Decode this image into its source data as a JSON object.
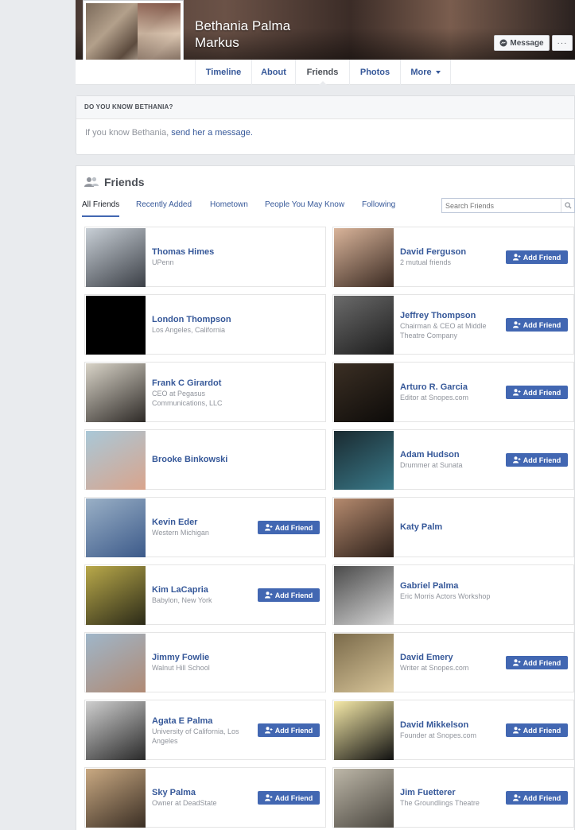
{
  "profile": {
    "name": "Bethania Palma Markus",
    "message_label": "Message",
    "more_dots": "···"
  },
  "tabs": [
    {
      "label": "Timeline"
    },
    {
      "label": "About"
    },
    {
      "label": "Friends"
    },
    {
      "label": "Photos"
    },
    {
      "label": "More"
    }
  ],
  "know_box": {
    "heading": "DO YOU KNOW BETHANIA?",
    "text": "If you know Bethania, ",
    "link": "send her a message.",
    "trail": ""
  },
  "friends": {
    "title": "Friends",
    "subtabs": [
      "All Friends",
      "Recently Added",
      "Hometown",
      "People You May Know",
      "Following"
    ],
    "search_placeholder": "Search Friends",
    "add_label": "Add Friend",
    "list": [
      {
        "name": "Thomas Himes",
        "sub": "UPenn",
        "add": false,
        "photo": [
          "#c8cfd6",
          "#3b3f46"
        ]
      },
      {
        "name": "David Ferguson",
        "sub": "2 mutual friends",
        "add": true,
        "photo": [
          "#d9b49a",
          "#3a2a22"
        ]
      },
      {
        "name": "London Thompson",
        "sub": "Los Angeles, California",
        "add": false,
        "photo": [
          "#000000",
          "#000000"
        ]
      },
      {
        "name": "Jeffrey Thompson",
        "sub": "Chairman & CEO at Middle Theatre Company",
        "add": true,
        "photo": [
          "#6b6b6b",
          "#1c1c1c"
        ]
      },
      {
        "name": "Frank C Girardot",
        "sub": "CEO at Pegasus Communications, LLC",
        "add": false,
        "photo": [
          "#d9d4c8",
          "#2e2a27"
        ]
      },
      {
        "name": "Arturo R. Garcia",
        "sub": "Editor at Snopes.com",
        "add": true,
        "photo": [
          "#3b2f24",
          "#0d0b09"
        ]
      },
      {
        "name": "Brooke Binkowski",
        "sub": "",
        "add": false,
        "photo": [
          "#a9c8d8",
          "#d9a48c"
        ]
      },
      {
        "name": "Adam Hudson",
        "sub": "Drummer at Sunata",
        "add": true,
        "photo": [
          "#1a2a30",
          "#3a7a8a"
        ]
      },
      {
        "name": "Kevin Eder",
        "sub": "Western Michigan",
        "add": true,
        "photo": [
          "#9ab0c6",
          "#3c5a8a"
        ]
      },
      {
        "name": "Katy Palm",
        "sub": "",
        "add": false,
        "photo": [
          "#b58a6e",
          "#2c201a"
        ]
      },
      {
        "name": "Kim LaCapria",
        "sub": "Babylon, New York",
        "add": true,
        "photo": [
          "#b9a94a",
          "#2b2a18"
        ]
      },
      {
        "name": "Gabriel Palma",
        "sub": "Eric Morris Actors Workshop",
        "add": false,
        "photo": [
          "#4a4a4a",
          "#d6d6d6"
        ]
      },
      {
        "name": "Jimmy Fowlie",
        "sub": "Walnut Hill School",
        "add": false,
        "photo": [
          "#9fb6c9",
          "#b08a74"
        ]
      },
      {
        "name": "David Emery",
        "sub": "Writer at Snopes.com",
        "add": true,
        "photo": [
          "#7a6a4a",
          "#d9c69a"
        ]
      },
      {
        "name": "Agata E Palma",
        "sub": "University of California, Los Angeles",
        "add": true,
        "photo": [
          "#cfcfcf",
          "#2a2a2a"
        ]
      },
      {
        "name": "David Mikkelson",
        "sub": "Founder at Snopes.com",
        "add": true,
        "photo": [
          "#f5e9a8",
          "#111111"
        ]
      },
      {
        "name": "Sky Palma",
        "sub": "Owner at DeadState",
        "add": true,
        "photo": [
          "#c9a982",
          "#3a2e24"
        ]
      },
      {
        "name": "Jim Fuetterer",
        "sub": "The Groundlings Theatre",
        "add": true,
        "photo": [
          "#bdb7a8",
          "#4a463f"
        ]
      }
    ]
  }
}
